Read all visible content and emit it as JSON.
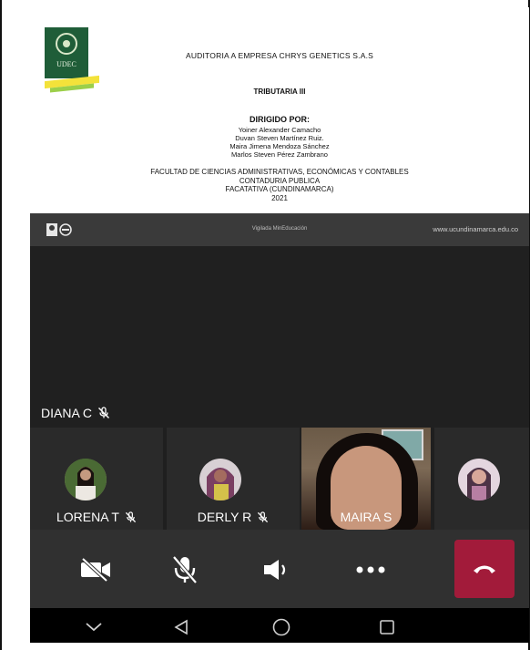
{
  "slide": {
    "title": "AUDITORIA  A EMPRESA CHRYS GENETICS S.A.S",
    "subject": "TRIBUTARIA III",
    "directed_by": "DIRIGIDO POR:",
    "names": [
      "Yoiner Alexander Camacho",
      "Duvan Steven Martínez Ruiz.",
      "Maira Jimena Mendoza Sánchez",
      "Marlos Steven Pérez Zambrano"
    ],
    "faculty": [
      "FACULTAD DE CIENCIAS ADMINISTRATIVAS, ECONÓMICAS Y CONTABLES",
      "CONTADURIA PUBLICA",
      "FACATATIVA (CUNDINAMARCA)",
      "2021"
    ],
    "logo_text": "UDEC",
    "footer_center": "Vigilada MinEducación",
    "footer_url": "www.ucundinamarca.edu.co"
  },
  "active_speaker": {
    "name": "DIANA C",
    "mic_icon": "mic-muted-icon"
  },
  "participants": [
    {
      "name": "LORENA T",
      "muted": true
    },
    {
      "name": "DERLY R",
      "muted": true
    },
    {
      "name": "MAIRA S",
      "muted": false
    },
    {
      "name": "",
      "muted": false
    }
  ],
  "controls": {
    "camera": "camera-off-icon",
    "mic": "mic-muted-icon",
    "speaker": "speaker-icon",
    "more": "more-icon",
    "end_call": "end-call-icon",
    "end_call_color": "#a21b3a"
  },
  "navbar": {
    "icons": [
      "chevron-down-icon",
      "back-triangle-icon",
      "home-circle-icon",
      "recents-square-icon"
    ]
  }
}
